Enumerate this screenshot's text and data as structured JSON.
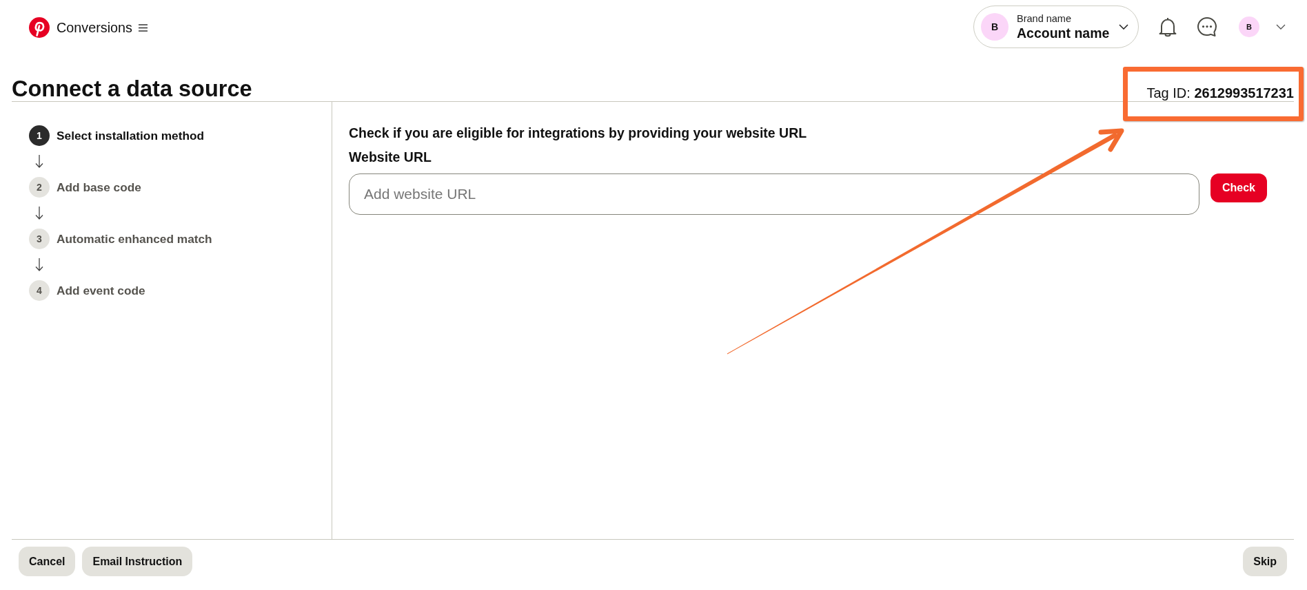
{
  "header": {
    "app_name": "Conversions",
    "account": {
      "avatar_initial": "B",
      "brand_name": "Brand name",
      "account_name": "Account name"
    },
    "user_avatar_initial": "B"
  },
  "page": {
    "title": "Connect a data source",
    "tag_id": "Tag ID: **2612993517231**"
  },
  "steps": [
    {
      "number": "1",
      "label": "Select installation method",
      "active": true
    },
    {
      "number": "2",
      "label": "Add base code",
      "active": false
    },
    {
      "number": "3",
      "label": "Automatic enhanced match",
      "active": false
    },
    {
      "number": "4",
      "label": "Add event code",
      "active": false
    }
  ],
  "form": {
    "heading": "Check if you are eligible for integrations by providing your website URL",
    "label": "Website URL",
    "url_field": {
      "placeholder": "Add website URL"
    },
    "check_button": "Check"
  },
  "footer": {
    "left_buttons": [
      "Cancel",
      "Email Instruction"
    ],
    "right_buttons": [
      "Skip"
    ]
  },
  "annotations": {
    "highlight_frame": true,
    "arrow": true
  }
}
